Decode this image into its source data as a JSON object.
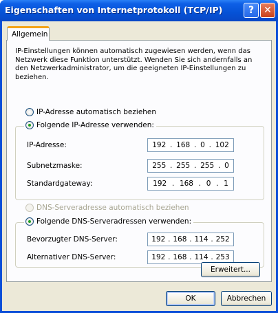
{
  "window": {
    "title": "Eigenschaften von Internetprotokoll (TCP/IP)",
    "help_label": "?",
    "close_label": "✕"
  },
  "tabs": [
    {
      "label": "Allgemein"
    }
  ],
  "intro_text": "IP-Einstellungen können automatisch zugewiesen werden, wenn das Netzwerk diese Funktion unterstützt. Wenden Sie sich andernfalls an den Netzwerkadministrator, um die geeigneten IP-Einstellungen zu beziehen.",
  "ip": {
    "auto_label": "IP-Adresse automatisch beziehen",
    "manual_label": "Folgende IP-Adresse verwenden:",
    "selected": "manual",
    "fields": [
      {
        "label": "IP-Adresse:",
        "octets": [
          "192",
          "168",
          "0",
          "102"
        ]
      },
      {
        "label": "Subnetzmaske:",
        "octets": [
          "255",
          "255",
          "255",
          "0"
        ]
      },
      {
        "label": "Standardgateway:",
        "octets": [
          "192",
          "168",
          "0",
          "1"
        ]
      }
    ]
  },
  "dns": {
    "auto_label": "DNS-Serveradresse automatisch beziehen",
    "manual_label": "Folgende DNS-Serveradressen verwenden:",
    "selected": "manual",
    "auto_disabled": true,
    "fields": [
      {
        "label": "Bevorzugter DNS-Server:",
        "octets": [
          "192",
          "168",
          "114",
          "252"
        ]
      },
      {
        "label": "Alternativer DNS-Server:",
        "octets": [
          "192",
          "168",
          "114",
          "253"
        ]
      }
    ]
  },
  "buttons": {
    "advanced": "Erweitert...",
    "ok": "OK",
    "cancel": "Abbrechen"
  },
  "colors": {
    "titlebar": "#0552d6",
    "dialog_bg": "#ece9d8",
    "tab_accent": "#f4a418",
    "radio_dot": "#21a121"
  }
}
